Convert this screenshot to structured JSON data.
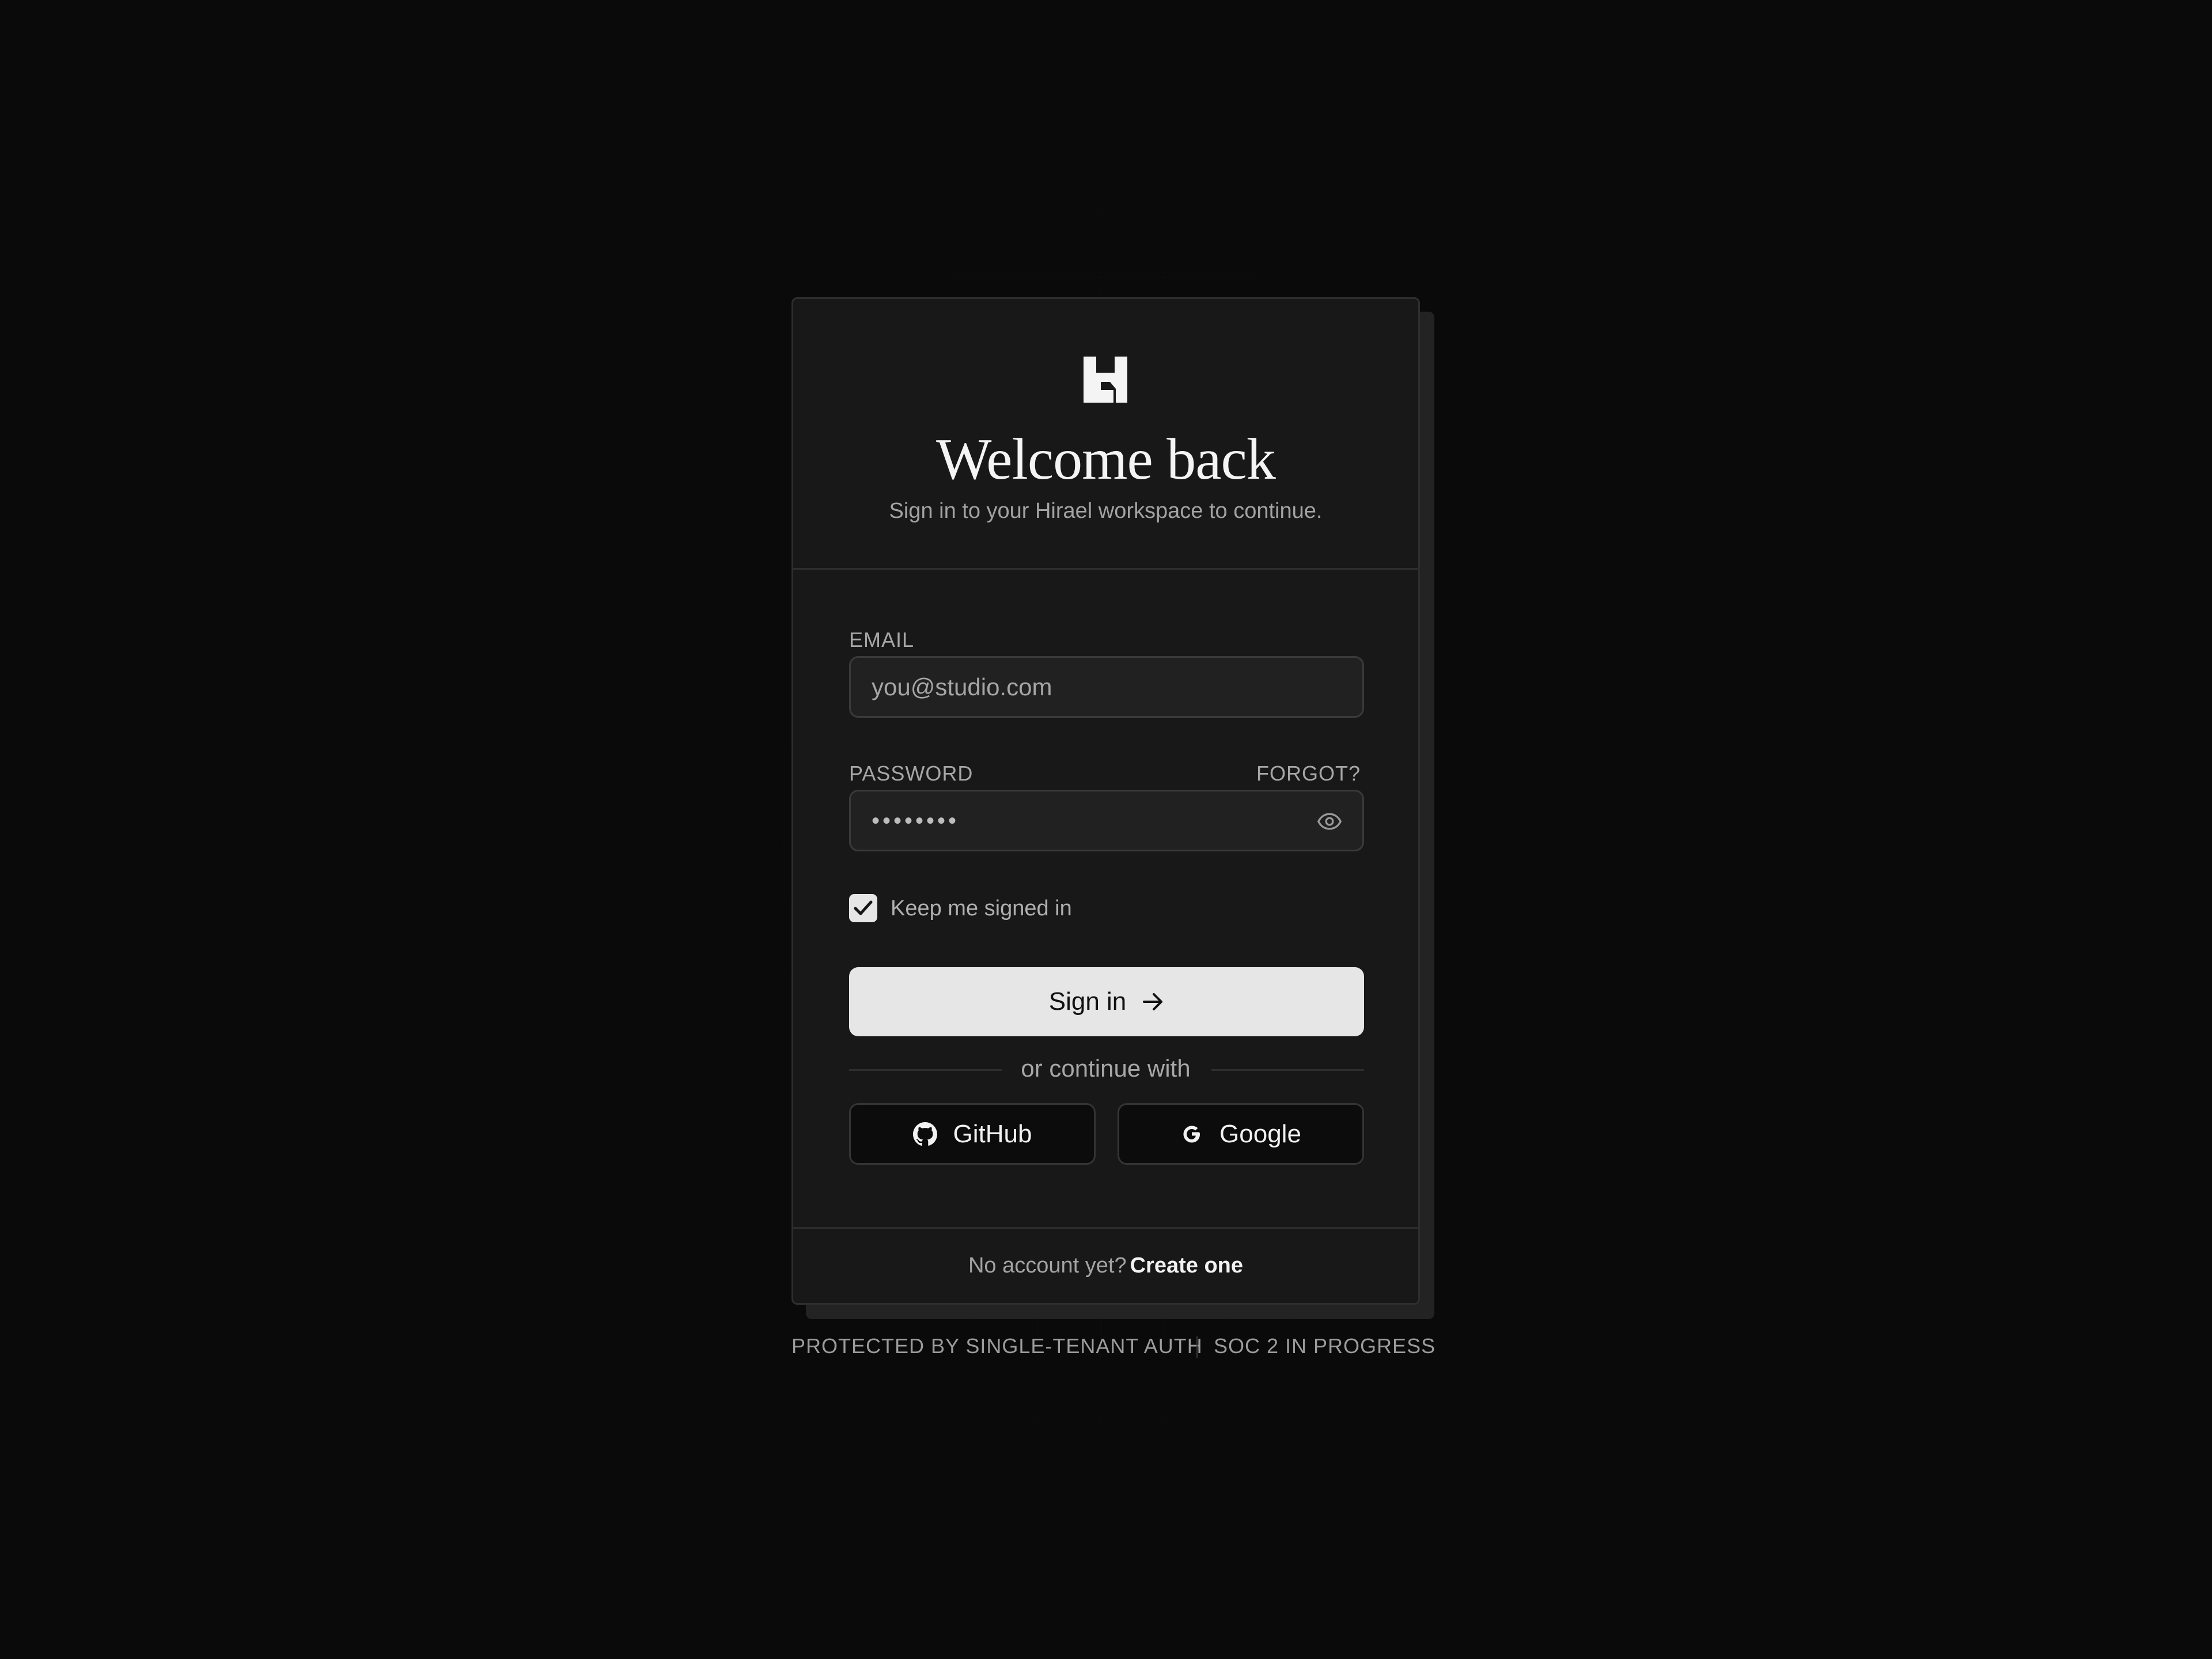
{
  "header": {
    "logo_icon": "hirael-logo-icon",
    "title": "Welcome back",
    "subtitle": "Sign in to your Hirael workspace to continue."
  },
  "form": {
    "email": {
      "label": "EMAIL",
      "value": "",
      "placeholder": "you@studio.com"
    },
    "password": {
      "label": "PASSWORD",
      "forgot_label": "FORGOT?",
      "masked_value": "••••••••",
      "reveal_icon": "eye-icon"
    },
    "remember": {
      "label": "Keep me signed in",
      "checked": true
    },
    "submit": {
      "label": "Sign in",
      "icon": "arrow-right-icon"
    },
    "divider_text": "or continue with",
    "social": [
      {
        "label": "GitHub",
        "icon": "github-icon"
      },
      {
        "label": "Google",
        "icon": "google-icon"
      }
    ]
  },
  "footer": {
    "prompt": "No account yet?",
    "link": "Create one"
  },
  "notes": {
    "left": "PROTECTED BY SINGLE-TENANT AUTH",
    "right": "SOC 2 IN PROGRESS"
  },
  "colors": {
    "background": "#0a0a0a",
    "card": "#181818",
    "primary_button": "#e6e6e6",
    "text_muted": "#a3a3a3"
  }
}
